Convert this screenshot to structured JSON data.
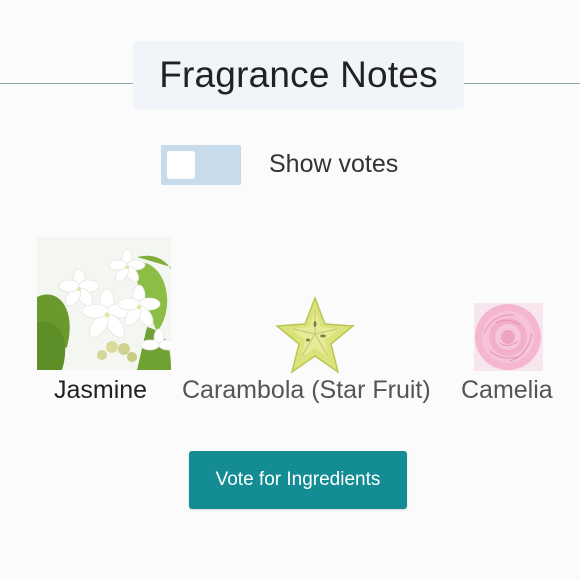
{
  "header": {
    "title": "Fragrance Notes"
  },
  "toggle": {
    "label": "Show votes",
    "checked": false,
    "track_color": "#c7dbea"
  },
  "notes": [
    {
      "label": "Jasmine",
      "image": "jasmine-flower-photo",
      "label_color": "#222222"
    },
    {
      "label": "Carambola (Star Fruit)",
      "image": "star-fruit-photo",
      "label_color": "#555555"
    },
    {
      "label": "Camelia",
      "image": "pink-camelia-photo",
      "label_color": "#555555"
    }
  ],
  "vote_button": {
    "label": "Vote for Ingredients",
    "color": "#138c93"
  }
}
